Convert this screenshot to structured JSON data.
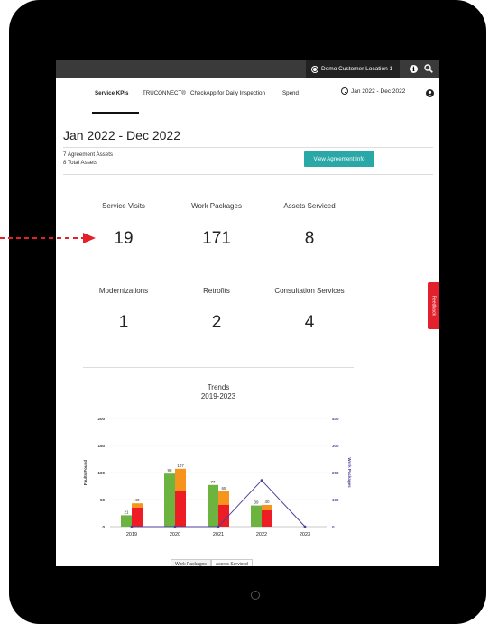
{
  "topbar": {
    "location_label": "Demo Customer Location 1"
  },
  "nav": {
    "tabs": [
      {
        "label": "Service KPIs",
        "active": true
      },
      {
        "label": "TRUCONNECT®",
        "active": false
      },
      {
        "label": "CheckApp for Daily Inspection",
        "active": false
      },
      {
        "label": "Spend",
        "active": false
      }
    ],
    "date_range": "Jan 2022 - Dec 2022"
  },
  "page": {
    "title": "Jan 2022 - Dec 2022",
    "agreement_assets": "7 Agreement Assets",
    "total_assets": "8 Total Assets",
    "agreement_button": "View Agreement Info"
  },
  "kpis": [
    {
      "label": "Service Visits",
      "value": "19"
    },
    {
      "label": "Work Packages",
      "value": "171"
    },
    {
      "label": "Assets Serviced",
      "value": "8"
    },
    {
      "label": "Modernizations",
      "value": "1"
    },
    {
      "label": "Retrofits",
      "value": "2"
    },
    {
      "label": "Consultation Services",
      "value": "4"
    }
  ],
  "trends": {
    "title": "Trends",
    "subtitle": "2019-2023"
  },
  "chart_data": {
    "type": "bar",
    "categories": [
      "2019",
      "2020",
      "2021",
      "2022",
      "2023"
    ],
    "ylabel": "Faults Found",
    "y2label": "Work Packages",
    "ylim": [
      0,
      200
    ],
    "y2lim": [
      0,
      400
    ],
    "yticks": [
      0,
      50,
      100,
      150,
      200
    ],
    "y2ticks": [
      0,
      100,
      200,
      300,
      400
    ],
    "series": [
      {
        "name": "Assets Serviced",
        "color": "#6db33f",
        "values": [
          21,
          98,
          77,
          39,
          0
        ],
        "labels": [
          "21",
          "98",
          "77",
          "39",
          ""
        ]
      },
      {
        "name": "",
        "color": "#f7941d",
        "values": [
          43,
          107,
          65,
          40,
          0
        ],
        "labels": [
          "43",
          "107",
          "65",
          "40",
          ""
        ]
      },
      {
        "name": "",
        "color": "#ee1c25",
        "values": [
          35,
          65,
          40,
          30,
          0
        ]
      },
      {
        "name": "Work Packages",
        "type": "line",
        "axis": "right",
        "color": "#4b4199",
        "values": [
          0,
          0,
          0,
          171,
          0
        ]
      }
    ],
    "legend": [
      "Work Packages",
      "Assets Serviced"
    ]
  },
  "feedback_label": "Feedback",
  "colors": {
    "accent": "#2aa7a7",
    "feedback": "#e3212c",
    "topbar": "#3a3a3a"
  }
}
